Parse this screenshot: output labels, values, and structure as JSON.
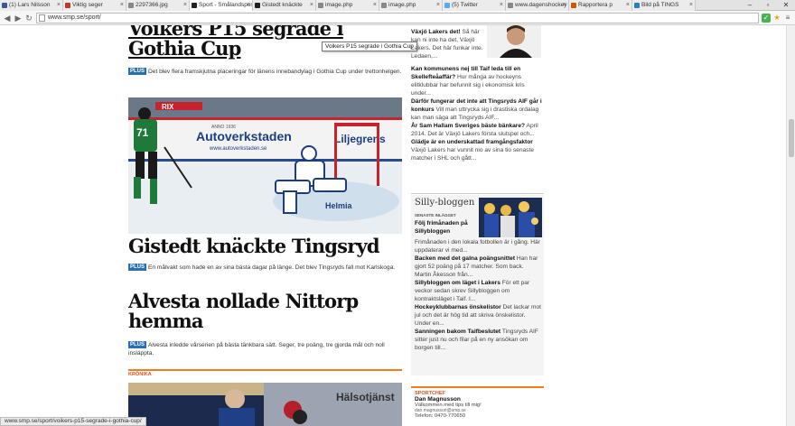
{
  "browser": {
    "tabs": [
      {
        "label": "(1) Lars Nilsson",
        "color": "#3b5998",
        "active": false
      },
      {
        "label": "Viktig seger",
        "color": "#c0392b",
        "active": false
      },
      {
        "label": "2297366.jpg",
        "color": "#888888",
        "active": false
      },
      {
        "label": "Sport - Smålandsposten",
        "color": "#222222",
        "active": true
      },
      {
        "label": "Gistedt knäckte",
        "color": "#222222",
        "active": false
      },
      {
        "label": "image.php",
        "color": "#888888",
        "active": false
      },
      {
        "label": "image.php",
        "color": "#888888",
        "active": false
      },
      {
        "label": "(5) Twitter",
        "color": "#55acee",
        "active": false
      },
      {
        "label": "www.dagenshockey",
        "color": "#888888",
        "active": false
      },
      {
        "label": "Rapportera p",
        "color": "#d35400",
        "active": false
      },
      {
        "label": "Bild på TINGS",
        "color": "#2980b9",
        "active": false
      }
    ],
    "url": "www.smp.se/sport/",
    "status_url": "www.smp.se/sport/voikers-p15-segrade-i-gothia-cup/",
    "tooltip": "Voikers P15 segrade i Gothia Cup"
  },
  "articles": [
    {
      "headline": "Voikers P15 segrade i Gothia Cup",
      "badge": "PLUS",
      "lead": "Det blev flera framskjutna placeringar för länens innebandylag i Gothia Cup under trettonhelgen."
    },
    {
      "headline": "Gistedt knäckte Tingsryd",
      "badge": "PLUS",
      "lead": "En målvakt som hade en av sina bästa dagar på länge. Det blev Tingsryds fall mot Karlskoga."
    },
    {
      "headline": "Alvesta nollade Nittorp hemma",
      "badge": "PLUS",
      "lead": "Alvesta inledde vårserien på bästa tänkbara sätt. Seger, tre poäng, tre gjorda mål och noll insläppta."
    }
  ],
  "hockey_image": {
    "board_text_1": "Autoverkstaden",
    "board_text_2": "www.autoverkstaden.se",
    "board_text_3": "RIX",
    "board_text_4": "Liljegrens",
    "board_text_5": "Helmia",
    "board_text_6": "ANNO 1936"
  },
  "section_label": "KRÖNIKA",
  "sidebar": {
    "top_items": [
      {
        "title": "Växjö Lakers det!",
        "text": "Så här kan ni inte ha det, Växjö Lakers. Det här funkar inte. Ledaen,..."
      },
      {
        "title": "Kan kommunens nej till Taif leda till en Skellefteåaffär?",
        "text": "Hur många av hockeyns elitklubbar har befunnit sig i ekonomisk kris under..."
      },
      {
        "title": "Därför fungerar det inte att Tingsryds AIF går i konkurs",
        "text": "Vill man uttrycka sig i drastiska ordalag kan man säga att Tingsryds AIF..."
      },
      {
        "title": "År Sam Hallam Sveriges bäste bänkare?",
        "text": "April 2014. Det är Växjö Lakers första slutspel och..."
      },
      {
        "title": "Glädje är en underskattad framgångsfaktor",
        "text": "Växjö Lakers har vunnit nio av sina tio senaste matcher i SHL och gått..."
      }
    ],
    "blog_title": "Silly-bloggen",
    "blog_kicker": "SENASTE INLÄGGET",
    "blog_items": [
      {
        "title": "Följ frimånaden på Sillybloggen",
        "text": "Frimånaden i den lokala fotbollen är i gång. Här uppdaterar vi med..."
      },
      {
        "title": "Backen med det galna poängsnittet",
        "text": "Han har gjort 52 poäng på 17 matcher. Som back. Martin Åkesson från..."
      },
      {
        "title": "Sillybloggen om läget i Lakers",
        "text": "För ett par veckor sedan skrev Sillybloggen om kontraktsläget i Taif. I..."
      },
      {
        "title": "Hockeyklubbarnas önskelistor",
        "text": "Det lackar mot jul och det är hög tid att skriva önskelistor. Under en..."
      },
      {
        "title": "Sanningen bakom Taifbeslutet",
        "text": "Tingsryds AIF sitter just nu och filar på en ny ansökan om borgen till..."
      }
    ],
    "sportchef_label": "SPORTCHEF",
    "sportchef_name": "Dan Magnusson",
    "sportchef_text": "Välkommen med tips till mig!",
    "sportchef_email": "dan.magnusson@smp.se",
    "sportchef_phone": "Telefon: 0470-770650"
  }
}
